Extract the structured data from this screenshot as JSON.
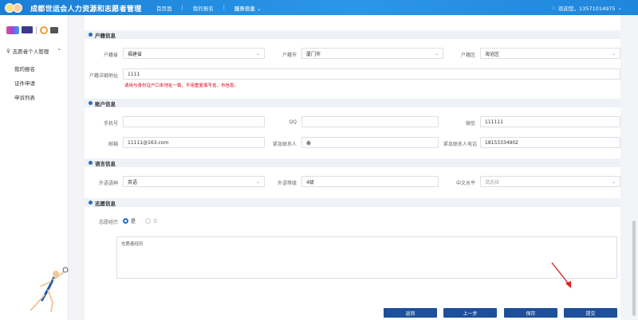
{
  "header": {
    "title": "成都世运会人力资源和志愿者管理",
    "nav": [
      "首页面",
      "我的报名",
      "服务信息"
    ],
    "user": "欢迎您，13571014975"
  },
  "sidebar": {
    "group": "志愿者个人管理",
    "items": [
      "我的报名",
      "证件申请",
      "申诉列表"
    ]
  },
  "sections": {
    "household": "户籍信息",
    "account": "账户信息",
    "language": "语言信息",
    "volunteer": "志愿信息"
  },
  "household": {
    "province_label": "户籍省",
    "province": "福建省",
    "city_label": "户籍市",
    "city": "厦门市",
    "district_label": "户籍区",
    "district": "海沧区",
    "address_label": "户籍详细地址",
    "address": "1111",
    "warning": "请用与身份证户口本地址一致，不用重复填写省、市信息。"
  },
  "account": {
    "phone_label": "手机号",
    "phone": "",
    "qq_label": "QQ",
    "qq": "",
    "wechat_label": "微信",
    "wechat": "111111",
    "email_label": "邮箱",
    "email": "11111@163.com",
    "contact_label": "紧急联系人",
    "contact": "秦",
    "contact_phone_label": "紧急联系人电话",
    "contact_phone": "18153334902"
  },
  "language": {
    "foreign_label": "外语语种",
    "foreign": "英语",
    "level_label": "外语等级",
    "level": "4级",
    "chinese_label": "中文水平",
    "chinese_placeholder": "请选择"
  },
  "volunteer": {
    "exp_label": "志愿经历",
    "yes": "是",
    "no": "否",
    "experience": "志愿者经历"
  },
  "buttons": {
    "back": "返回",
    "prev": "上一步",
    "save": "保存",
    "submit": "提交"
  }
}
